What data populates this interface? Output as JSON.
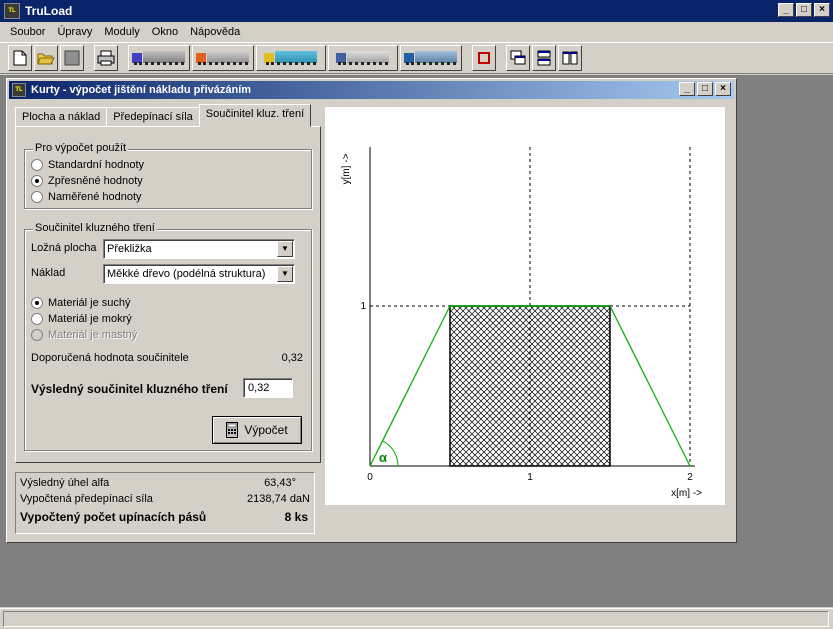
{
  "app": {
    "title": "TruLoad",
    "icon_text": "TruLoad"
  },
  "menu": [
    "Soubor",
    "Úpravy",
    "Moduly",
    "Okno",
    "Nápověda"
  ],
  "toolbar": {
    "buttons": [
      "new-icon",
      "open-icon",
      "save-icon",
      "print-icon",
      "truck1-icon",
      "truck2-icon",
      "truck3-icon",
      "truck4-icon",
      "truck5-icon",
      "erase-icon",
      "cascade-icon",
      "tile-horizontal-icon",
      "tile-vertical-icon"
    ]
  },
  "child": {
    "title": "Kurty - výpočet jištění nákladu přivázáním",
    "tabs": [
      "Plocha a náklad",
      "Předepínací síla",
      "Součinitel kluz. tření"
    ],
    "active_tab": 2,
    "group1": {
      "label": "Pro výpočet použít",
      "options": [
        "Standardní hodnoty",
        "Zpřesněné hodnoty",
        "Naměřené hodnoty"
      ],
      "selected": 1
    },
    "group2": {
      "label": "Součinitel kluzného tření",
      "surface_label": "Ložná plocha",
      "surface_value": "Překližka",
      "load_label": "Náklad",
      "load_value": "Měkké dřevo (podélná struktura)",
      "state_options": [
        "Materiál je suchý",
        "Materiál je mokrý",
        "Materiál je mastný"
      ],
      "state_selected": 0,
      "recommended_label": "Doporučená hodnota součinitele",
      "recommended_value": "0,32",
      "result_label": "Výsledný součinitel kluzného tření",
      "result_value": "0,32"
    },
    "compute_button": "Výpočet",
    "results": {
      "angle_label": "Výsledný úhel alfa",
      "angle_value": "63,43°",
      "force_label": "Vypočtená předepínací síla",
      "force_value": "2138,74 daN",
      "count_label": "Vypočtený počet upínacích pásů",
      "count_value": "8  ks"
    }
  },
  "chart_data": {
    "type": "line",
    "ylabel": "y[m] ->",
    "xlabel": "x[m] ->",
    "x_ticks": [
      "0",
      "1",
      "2"
    ],
    "y_ticks": [
      "1"
    ],
    "xlim": [
      0,
      2
    ],
    "ylim": [
      0,
      1
    ],
    "cargo_box": {
      "x0": 0.5,
      "x1": 1.5,
      "y0": 0,
      "y1": 1
    },
    "strap_left": [
      [
        0,
        0
      ],
      [
        0.5,
        1
      ]
    ],
    "strap_right": [
      [
        1.5,
        1
      ],
      [
        2,
        0
      ]
    ],
    "angle_label": "α",
    "colors": {
      "strap": "#00aa00",
      "angle": "#008800"
    }
  }
}
